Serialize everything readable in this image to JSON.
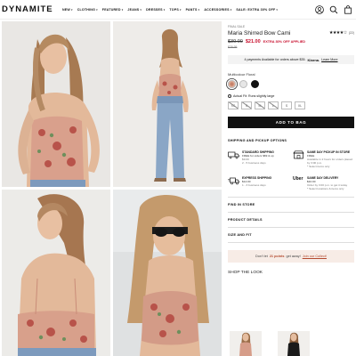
{
  "header": {
    "logo": "DYNAMITE",
    "nav": [
      {
        "label": "NEW",
        "chevron": true
      },
      {
        "label": "CLOTHING",
        "chevron": true
      },
      {
        "label": "FEATURED",
        "chevron": true
      },
      {
        "label": "JEANS",
        "chevron": true
      },
      {
        "label": "DRESSES",
        "chevron": true
      },
      {
        "label": "TOPS",
        "chevron": true
      },
      {
        "label": "PANTS",
        "chevron": true
      },
      {
        "label": "ACCESSORIES",
        "chevron": true
      },
      {
        "label": "SALE: EXTRA 30% OFF",
        "chevron": true
      }
    ],
    "icons": [
      "account-icon",
      "search-icon",
      "bag-icon"
    ]
  },
  "product": {
    "final_sale_tag": "FINAL SALE",
    "title": "Maria Shirred Bow Cami",
    "rating_stars": "★★★★☆",
    "rating": 4,
    "reviews": "(22)",
    "old_price": "$30.00",
    "new_price": "$21.00",
    "promo": "EXTRA 30% OFF APPLIED",
    "final_price": "$29.95",
    "klarna_text": "4 payments Available for orders above $35.",
    "klarna_brand": "Klarna.",
    "klarna_link": "Learn More",
    "color_label": "Multicolour Floral",
    "swatches": [
      "#c7826a",
      "#e6e6e6",
      "#111111"
    ],
    "fit_text": "Actual Fit: Runs slightly large",
    "sizes": [
      {
        "label": "XS",
        "available": false
      },
      {
        "label": "S",
        "available": false
      },
      {
        "label": "M",
        "available": false
      },
      {
        "label": "L",
        "available": false
      },
      {
        "label": "S",
        "available": true
      },
      {
        "label": "XL",
        "available": true
      }
    ],
    "add_to_bag": "ADD TO BAG"
  },
  "shipping": {
    "title": "SHIPPING AND PICKUP OPTIONS",
    "options": [
      {
        "icon": "truck-icon",
        "title": "STANDARD SHIPPING",
        "lines": [
          "FREE for orders $69 & up",
          "$9.00",
          "2 - 5 business days"
        ]
      },
      {
        "icon": "store-icon",
        "title": "SAME DAY PICKUP IN STORE",
        "lines": [
          "FREE",
          "Available in 2 hours for orders placed by 3:00 p.m.",
          "* Select items only"
        ]
      },
      {
        "icon": "express-truck-icon",
        "title": "EXPRESS SHIPPING",
        "lines": [
          "$14.00",
          "1 - 3 business days"
        ]
      },
      {
        "icon": "uber-logo",
        "logo_text": "Uber",
        "title": "SAME DAY DELIVERY",
        "lines": [
          "$10.00",
          "Order by 3:00 p.m. to get it today",
          "* Select locations & items only"
        ]
      }
    ]
  },
  "accordions": [
    "FIND IN STORE",
    "PRODUCT DETAILS",
    "SIZE AND FIT"
  ],
  "points": {
    "prefix": "Don't let",
    "highlight": "21 points",
    "suffix": "get away!",
    "link": "Join our Collect!"
  },
  "shop_the_look": "SHOP THE LOOK"
}
